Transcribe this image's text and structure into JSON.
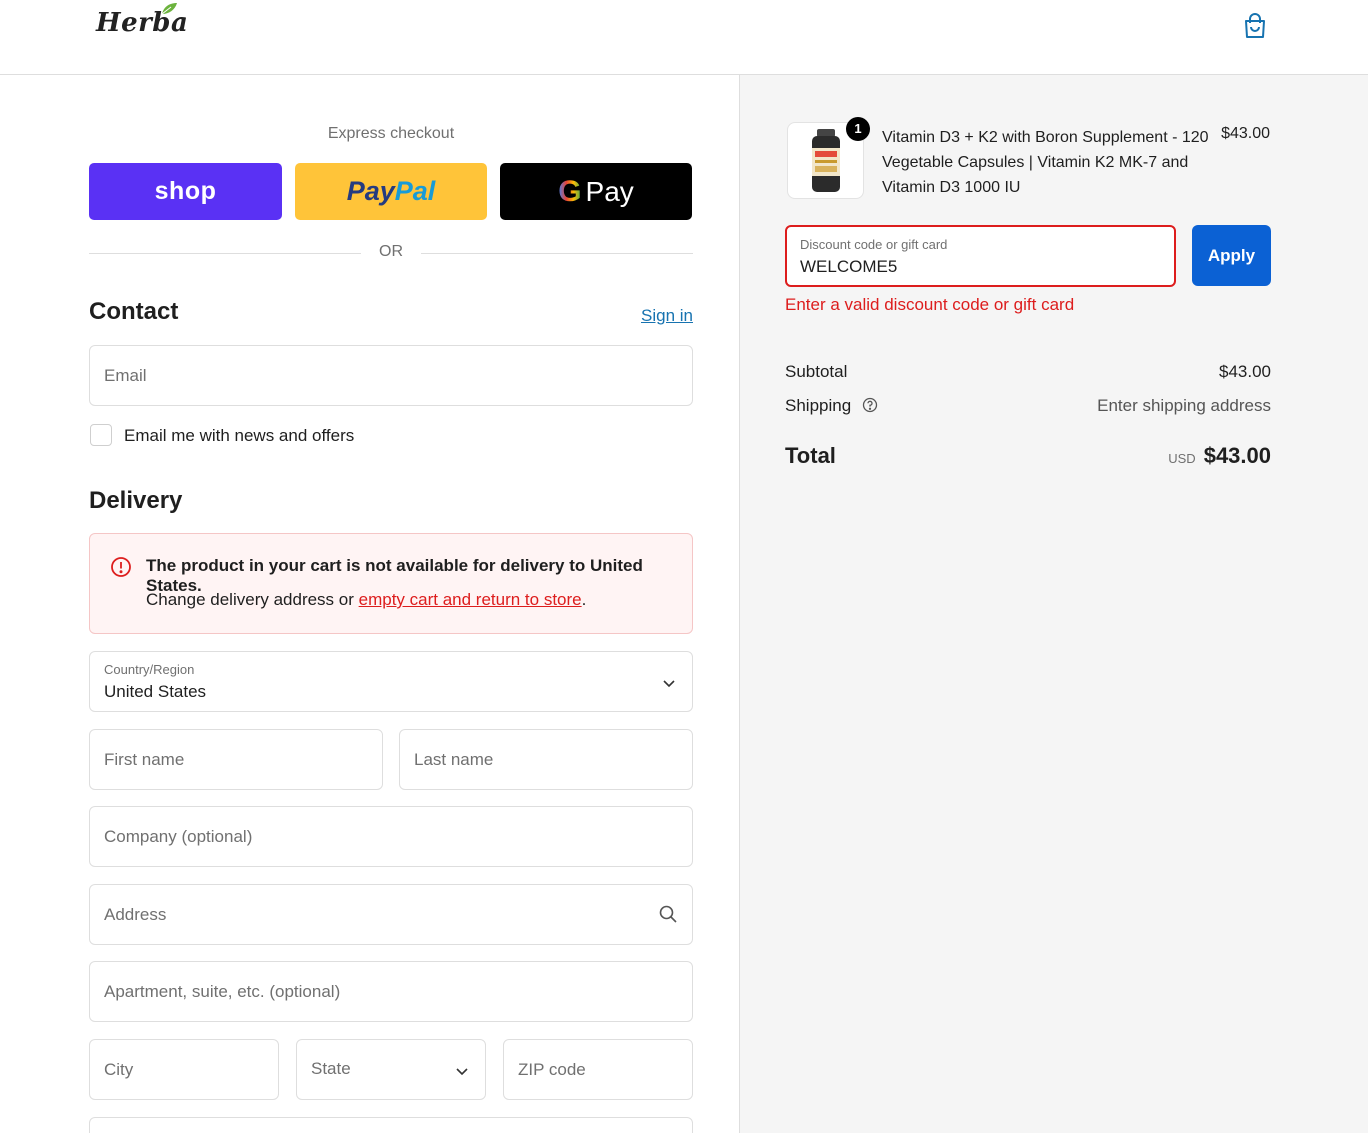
{
  "header": {
    "logo_text": "Herba",
    "cart_icon": "shopping-bag-icon"
  },
  "express": {
    "title": "Express checkout",
    "shop_label": "shop",
    "paypal_label_1": "Pay",
    "paypal_label_2": "Pal",
    "gpay_g": "G",
    "gpay_label": "Pay",
    "or_text": "OR"
  },
  "contact": {
    "title": "Contact",
    "signin_label": "Sign in",
    "email_placeholder": "Email",
    "newsletter_label": "Email me with news and offers"
  },
  "delivery": {
    "title": "Delivery",
    "alert_title": "The product in your cart is not available for delivery to United States.",
    "alert_text": "Change delivery address or ",
    "alert_link": "empty cart and return to store",
    "alert_end": ".",
    "country_label": "Country/Region",
    "country_value": "United States",
    "first_name_placeholder": "First name",
    "last_name_placeholder": "Last name",
    "company_placeholder": "Company (optional)",
    "address_placeholder": "Address",
    "apartment_placeholder": "Apartment, suite, etc. (optional)",
    "city_placeholder": "City",
    "state_placeholder": "State",
    "zip_placeholder": "ZIP code"
  },
  "summary": {
    "product": {
      "quantity": "1",
      "name": "Vitamin D3 + K2 with Boron Supplement - 120 Vegetable Capsules | Vitamin K2 MK-7 and Vitamin D3 1000 IU",
      "price": "$43.00"
    },
    "discount": {
      "label": "Discount code or gift card",
      "value": "WELCOME5",
      "apply_label": "Apply",
      "error": "Enter a valid discount code or gift card"
    },
    "subtotal_label": "Subtotal",
    "subtotal_value": "$43.00",
    "shipping_label": "Shipping",
    "shipping_value": "Enter shipping address",
    "total_label": "Total",
    "total_currency": "USD",
    "total_value": "$43.00"
  },
  "colors": {
    "shop": "#5a31f4",
    "paypal": "#ffc439",
    "apply": "#0b61d4",
    "error": "#dd1d1d",
    "link": "#1773b0"
  }
}
